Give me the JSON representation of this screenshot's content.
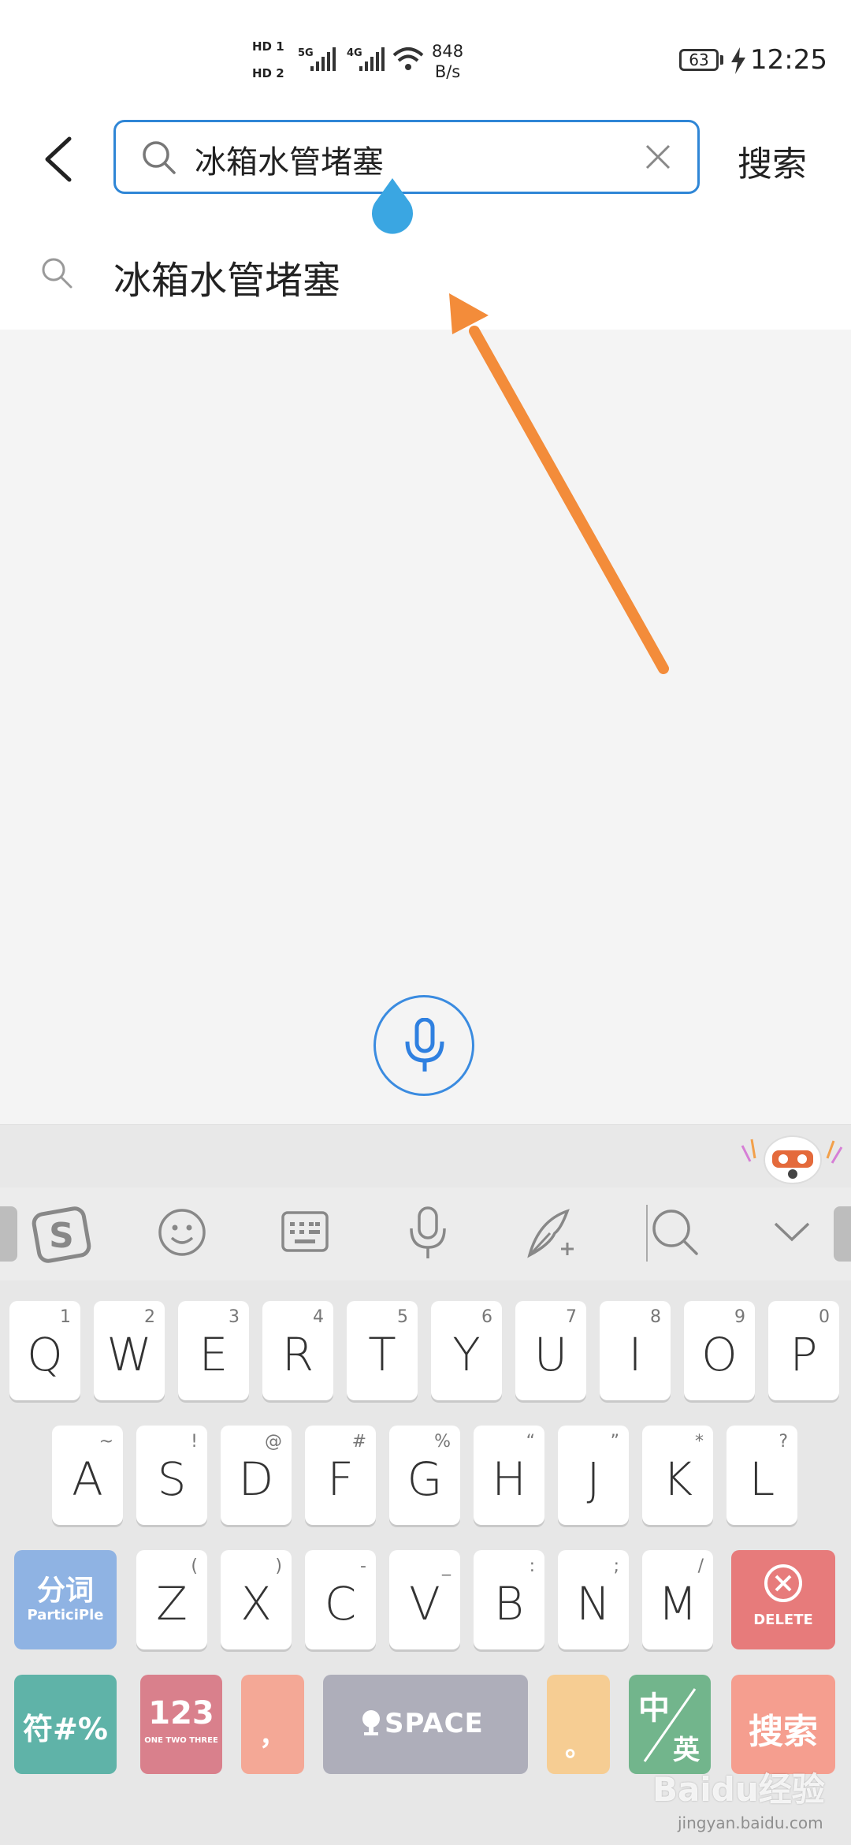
{
  "status_bar": {
    "sim1": "HD 1",
    "sim2": "HD 2",
    "net1": "5G",
    "net2": "4G",
    "speed_value": "848",
    "speed_unit": "B/s",
    "battery": "63",
    "time": "12:25"
  },
  "header": {
    "search_value": "冰箱水管堵塞",
    "search_button": "搜索"
  },
  "suggestion": {
    "text": "冰箱水管堵塞"
  },
  "keyboard": {
    "row1": [
      {
        "main": "Q",
        "sub": "1"
      },
      {
        "main": "W",
        "sub": "2"
      },
      {
        "main": "E",
        "sub": "3"
      },
      {
        "main": "R",
        "sub": "4"
      },
      {
        "main": "T",
        "sub": "5"
      },
      {
        "main": "Y",
        "sub": "6"
      },
      {
        "main": "U",
        "sub": "7"
      },
      {
        "main": "I",
        "sub": "8"
      },
      {
        "main": "O",
        "sub": "9"
      },
      {
        "main": "P",
        "sub": "0"
      }
    ],
    "row2": [
      {
        "main": "A",
        "sub": "~"
      },
      {
        "main": "S",
        "sub": "!"
      },
      {
        "main": "D",
        "sub": "@"
      },
      {
        "main": "F",
        "sub": "#"
      },
      {
        "main": "G",
        "sub": "%"
      },
      {
        "main": "H",
        "sub": "“"
      },
      {
        "main": "J",
        "sub": "”"
      },
      {
        "main": "K",
        "sub": "*"
      },
      {
        "main": "L",
        "sub": "?"
      }
    ],
    "row3": [
      {
        "main": "Z",
        "sub": "("
      },
      {
        "main": "X",
        "sub": ")"
      },
      {
        "main": "C",
        "sub": "-"
      },
      {
        "main": "V",
        "sub": "_"
      },
      {
        "main": "B",
        "sub": ":"
      },
      {
        "main": "N",
        "sub": ";"
      },
      {
        "main": "M",
        "sub": "/"
      }
    ],
    "fenci_label": "分词",
    "fenci_sub": "ParticiPle",
    "delete_label": "DELETE",
    "symbols_label": "符#%",
    "num_label": "123",
    "num_sub": "ONE TWO THREE",
    "comma_label": "，",
    "space_label": "SPACE",
    "period_label": "。",
    "lang_zh": "中",
    "lang_en": "英",
    "enter_label": "搜索",
    "colors": {
      "fenci": "#8fb3e3",
      "delete": "#e77b7b",
      "symbols": "#5fb3a8",
      "num": "#d9808c",
      "comma": "#f4a896",
      "space": "#aeaeba",
      "period": "#f6cd93",
      "lang": "#72b58c",
      "enter": "#f59e8f"
    }
  },
  "watermark": {
    "text": "Baidu经验",
    "url": "jingyan.baidu.com"
  }
}
